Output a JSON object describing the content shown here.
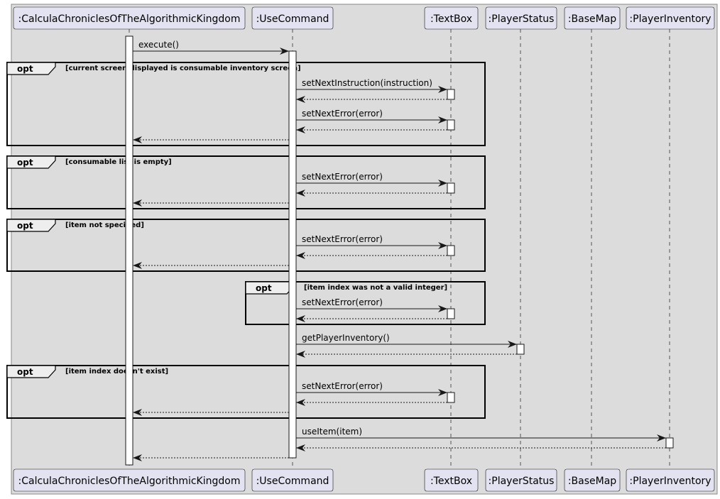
{
  "diagram": {
    "type": "sequence",
    "colors": {
      "background": "#dcdcdc",
      "participant_fill": "#e2e2f0",
      "participant_border": "#181818",
      "frame_tab_fill": "#eeeeee",
      "line": "#181818",
      "activation_fill": "#ffffff"
    },
    "participants": [
      {
        "id": "game",
        "label": ":CalculaChroniclesOfTheAlgorithmicKingdom"
      },
      {
        "id": "use",
        "label": ":UseCommand"
      },
      {
        "id": "textbox",
        "label": ":TextBox"
      },
      {
        "id": "status",
        "label": ":PlayerStatus"
      },
      {
        "id": "basemap",
        "label": ":BaseMap"
      },
      {
        "id": "inventory",
        "label": ":PlayerInventory"
      }
    ],
    "messages": [
      {
        "from": "game",
        "to": "use",
        "label": "execute()",
        "kind": "call"
      },
      {
        "from": "use",
        "to": "textbox",
        "label": "setNextInstruction(instruction)",
        "kind": "call"
      },
      {
        "from": "textbox",
        "to": "use",
        "label": "",
        "kind": "return"
      },
      {
        "from": "use",
        "to": "textbox",
        "label": "setNextError(error)",
        "kind": "call"
      },
      {
        "from": "textbox",
        "to": "use",
        "label": "",
        "kind": "return"
      },
      {
        "from": "use",
        "to": "game",
        "label": "",
        "kind": "return"
      },
      {
        "from": "use",
        "to": "textbox",
        "label": "setNextError(error)",
        "kind": "call"
      },
      {
        "from": "textbox",
        "to": "use",
        "label": "",
        "kind": "return"
      },
      {
        "from": "use",
        "to": "game",
        "label": "",
        "kind": "return"
      },
      {
        "from": "use",
        "to": "textbox",
        "label": "setNextError(error)",
        "kind": "call"
      },
      {
        "from": "textbox",
        "to": "use",
        "label": "",
        "kind": "return"
      },
      {
        "from": "use",
        "to": "game",
        "label": "",
        "kind": "return"
      },
      {
        "from": "use",
        "to": "textbox",
        "label": "setNextError(error)",
        "kind": "call"
      },
      {
        "from": "textbox",
        "to": "use",
        "label": "",
        "kind": "return"
      },
      {
        "from": "use",
        "to": "status",
        "label": "getPlayerInventory()",
        "kind": "call"
      },
      {
        "from": "status",
        "to": "use",
        "label": "",
        "kind": "return"
      },
      {
        "from": "use",
        "to": "textbox",
        "label": "setNextError(error)",
        "kind": "call"
      },
      {
        "from": "textbox",
        "to": "use",
        "label": "",
        "kind": "return"
      },
      {
        "from": "use",
        "to": "game",
        "label": "",
        "kind": "return"
      },
      {
        "from": "use",
        "to": "inventory",
        "label": "useItem(item)",
        "kind": "call"
      },
      {
        "from": "inventory",
        "to": "use",
        "label": "",
        "kind": "return"
      },
      {
        "from": "use",
        "to": "game",
        "label": "",
        "kind": "return"
      }
    ],
    "fragments": [
      {
        "keyword": "opt",
        "guard": "[current screen displayed is consumable inventory screen]"
      },
      {
        "keyword": "opt",
        "guard": "[consumable list is empty]"
      },
      {
        "keyword": "opt",
        "guard": "[item not specified]"
      },
      {
        "keyword": "opt",
        "guard": "[item index was not a valid integer]"
      },
      {
        "keyword": "opt",
        "guard": "[item index doesn't exist]"
      }
    ]
  }
}
